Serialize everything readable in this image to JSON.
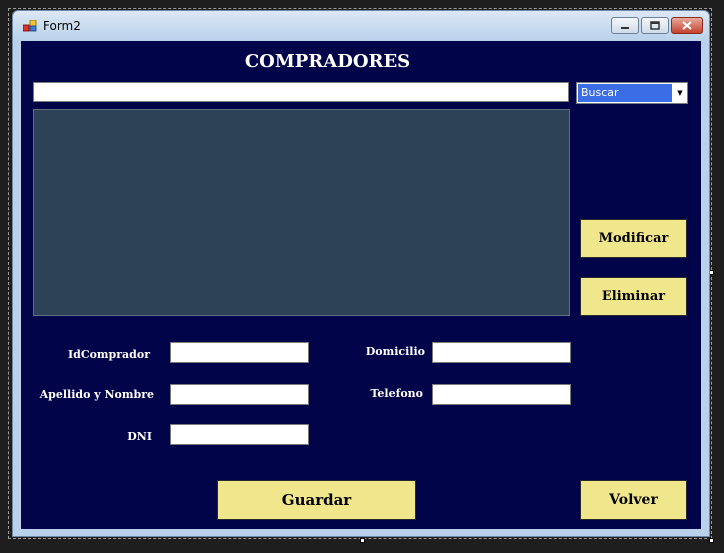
{
  "window": {
    "title": "Form2",
    "minimize_label": "",
    "maximize_label": "",
    "close_label": ""
  },
  "form": {
    "heading": "COMPRADORES",
    "search_value": "",
    "search_combo": {
      "selected": "Buscar"
    },
    "buttons": {
      "modificar": "Modificar",
      "eliminar": "Eliminar",
      "guardar": "Guardar",
      "volver": "Volver"
    },
    "fields": {
      "idcomprador": {
        "label": "IdComprador",
        "value": ""
      },
      "apellido_nombre": {
        "label": "Apellido y Nombre",
        "value": ""
      },
      "dni": {
        "label": "DNI",
        "value": ""
      },
      "domicilio": {
        "label": "Domicilio",
        "value": ""
      },
      "telefono": {
        "label": "Telefono",
        "value": ""
      }
    }
  },
  "colors": {
    "form_background": "#02044a",
    "button_background": "#f0e68c",
    "grid_background": "#2d4257",
    "combo_highlight": "#3b6ee6"
  },
  "icons": [
    "app-icon",
    "minimize-icon",
    "maximize-icon",
    "close-icon",
    "dropdown-arrow-icon"
  ]
}
